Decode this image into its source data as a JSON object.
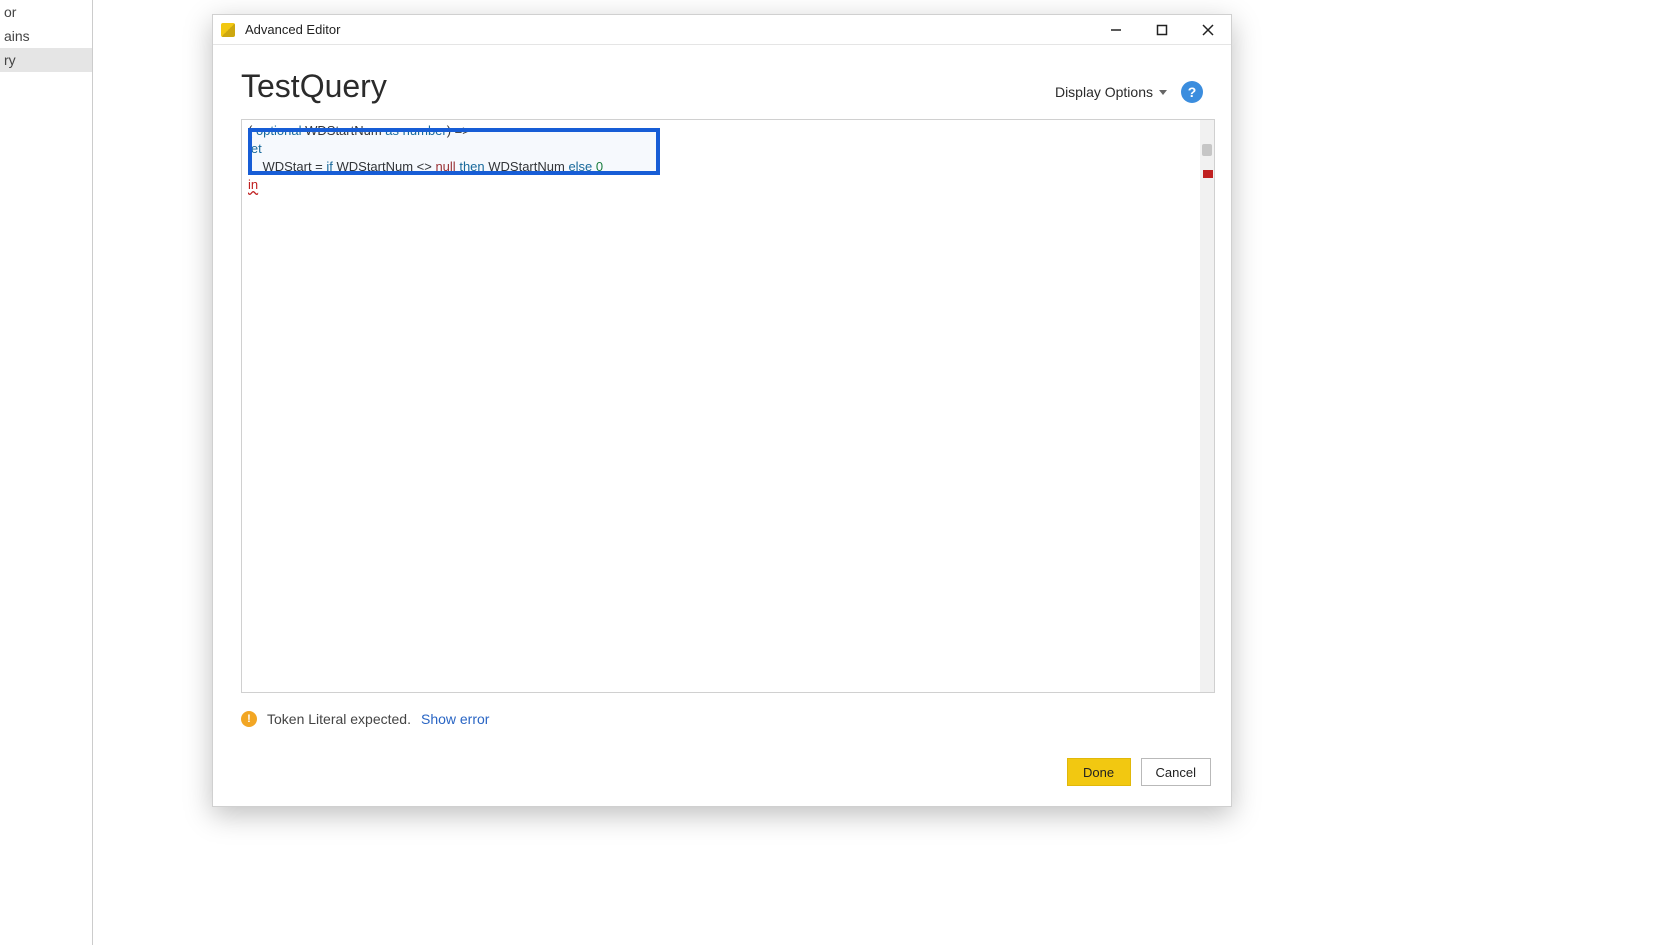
{
  "sidebar": {
    "items": [
      "or",
      "ains",
      "ry"
    ],
    "selected_index": 2
  },
  "dialog": {
    "title": "Advanced Editor",
    "query_name": "TestQuery",
    "display_options_label": "Display Options",
    "done_label": "Done",
    "cancel_label": "Cancel"
  },
  "code": {
    "line1_prefix": "( ",
    "line1_kw1": "optional",
    "line1_mid": " WDStartNum ",
    "line1_kw2": "as",
    "line1_sp": " ",
    "line1_type": "number",
    "line1_suffix": ") =>",
    "line2": "let",
    "line3_prefix": "    WDStart = ",
    "line3_kw1": "if",
    "line3_mid1": " WDStartNum <> ",
    "line3_null": "null",
    "line3_sp1": " ",
    "line3_kw_then": "then",
    "line3_mid2": " WDStartNum ",
    "line3_kw_else": "else",
    "line3_sp2": " ",
    "line3_zero": "0",
    "line4": "in"
  },
  "error": {
    "message": "Token Literal expected.",
    "link": "Show error"
  }
}
